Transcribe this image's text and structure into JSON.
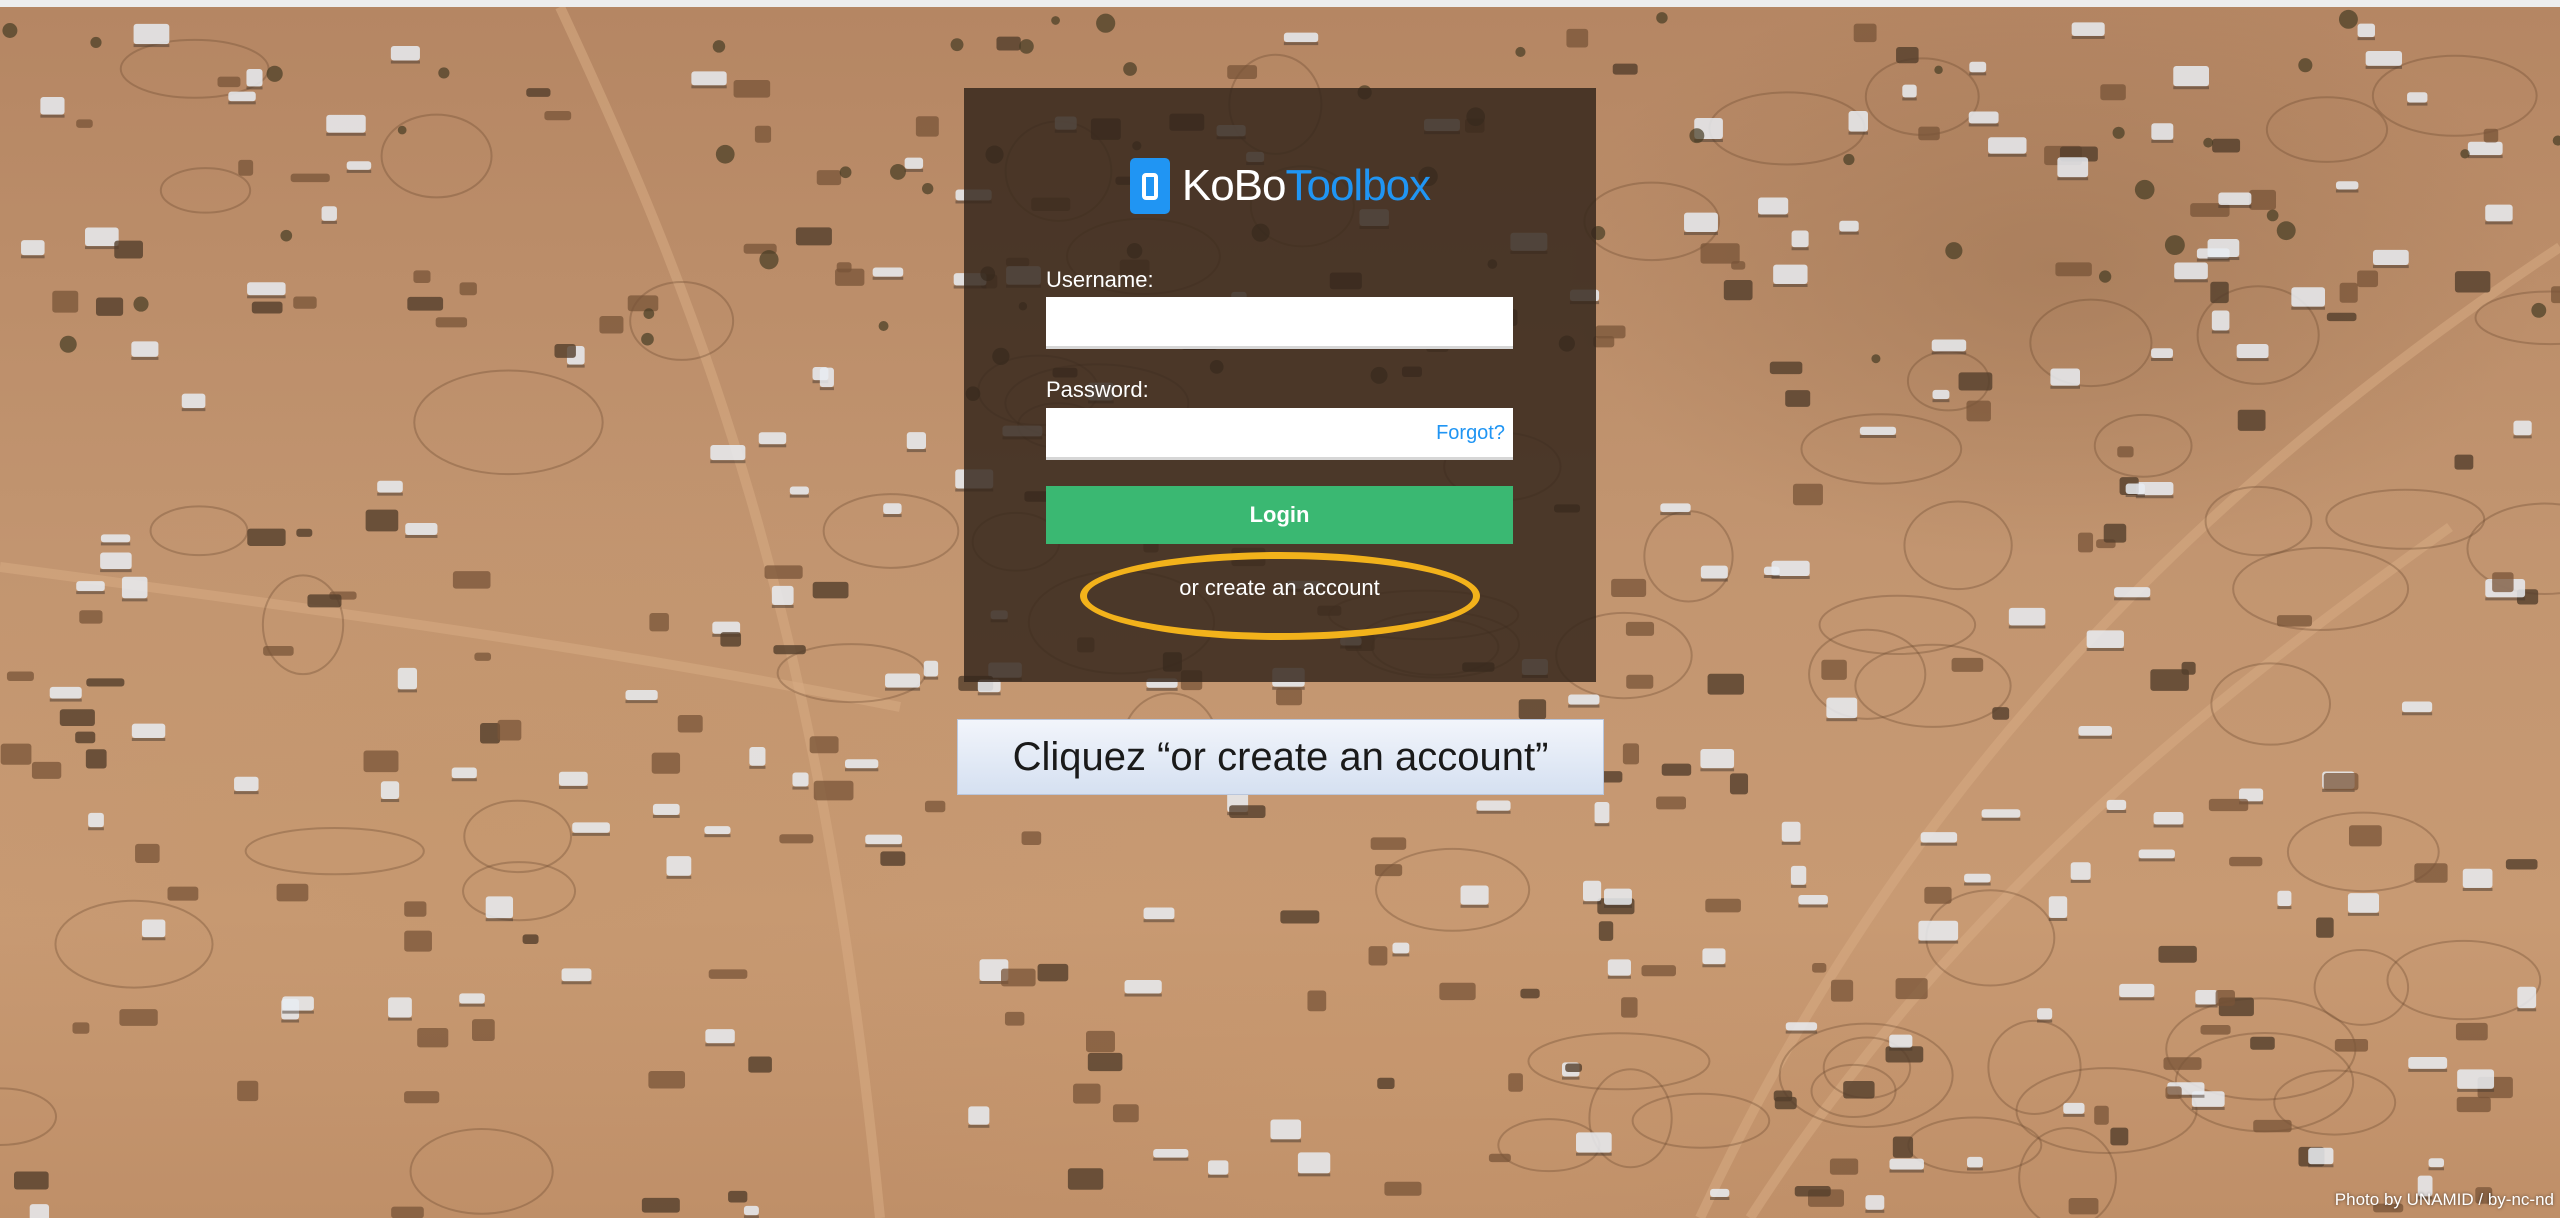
{
  "login": {
    "logo": {
      "icon": "kobo-logo-icon",
      "brand_part1": "KoBo",
      "brand_part2": "Toolbox",
      "brand_color": "#2095f3"
    },
    "username_label": "Username:",
    "username_value": "",
    "password_label": "Password:",
    "password_value": "",
    "forgot_label": "Forgot?",
    "login_button": "Login",
    "login_button_color": "#3ab872",
    "create_account": "or create an account"
  },
  "annotation": {
    "caption": "Cliquez “or create an account”",
    "highlight_color": "#f2b21b"
  },
  "photo_credit": "Photo by UNAMID / by-nc-nd"
}
